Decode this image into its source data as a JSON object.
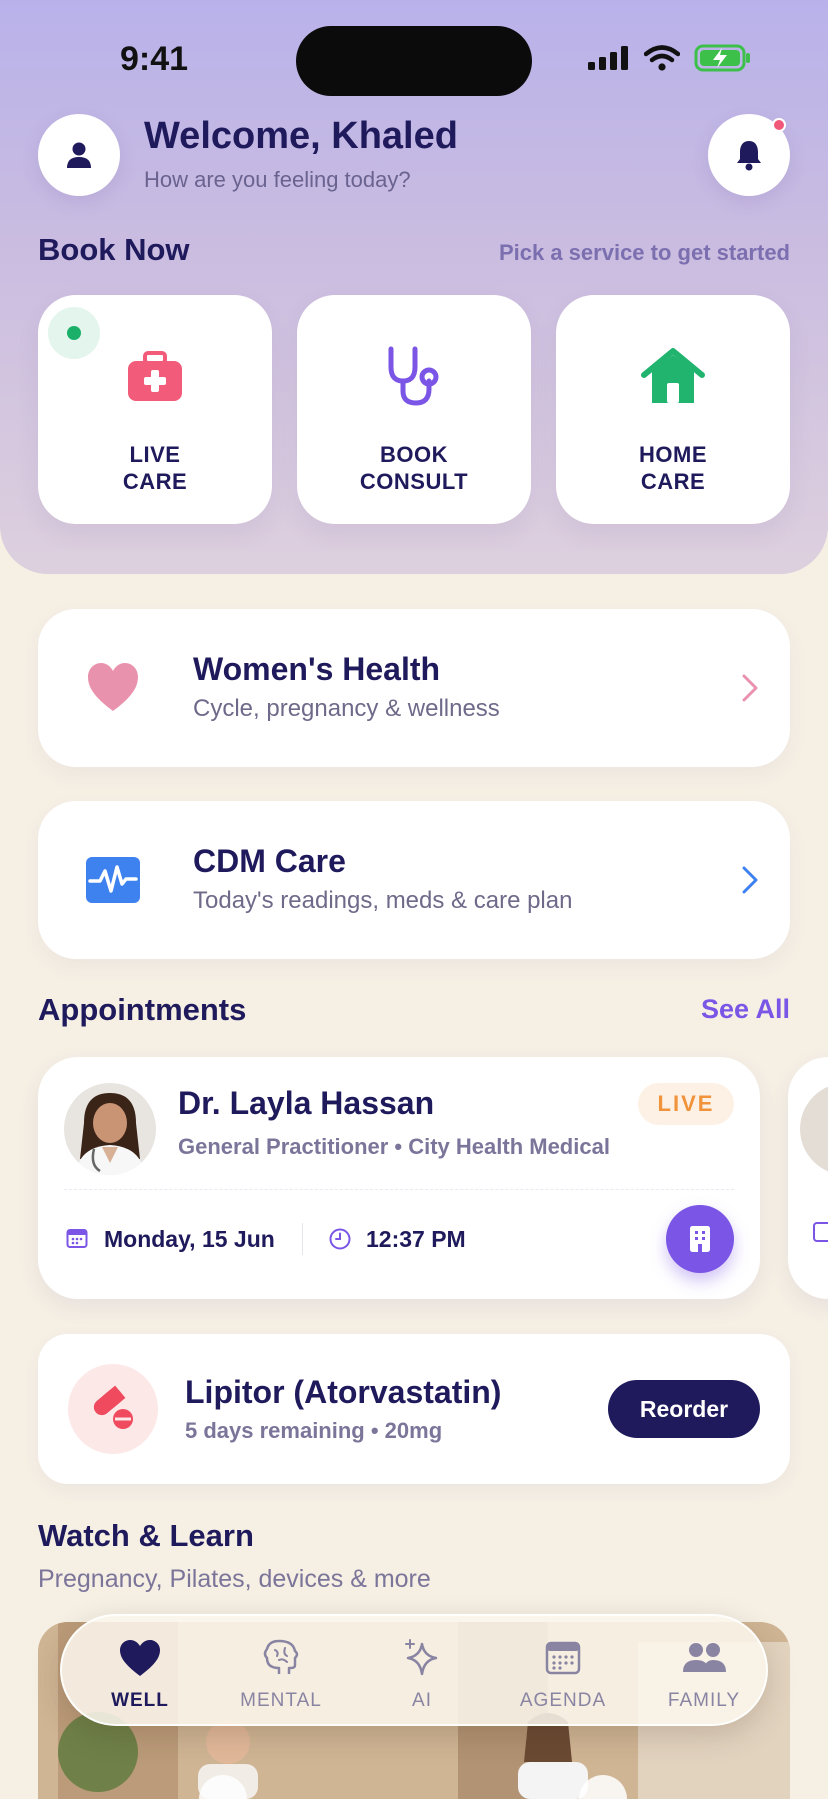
{
  "colors": {
    "primary": "#1f1a5c",
    "accent": "#7a55e6",
    "live": "#f0933a",
    "online": "#1bb06a",
    "heart": "#e992ae",
    "cdm": "#3e82f0"
  },
  "status_bar": {
    "time": "9:41"
  },
  "header": {
    "greeting": "Welcome, Khaled",
    "subtitle": "How are you feeling today?"
  },
  "book_now": {
    "title": "Book Now",
    "hint": "Pick a service to get started",
    "services": [
      {
        "label": "LIVE\nCARE",
        "icon": "first-aid-kit-icon"
      },
      {
        "label": "BOOK\nCONSULT",
        "icon": "stethoscope-icon"
      },
      {
        "label": "HOME\nCARE",
        "icon": "house-icon"
      }
    ]
  },
  "womens_health": {
    "title": "Women's Health",
    "subtitle": "Cycle, pregnancy & wellness",
    "icon": "heart-icon"
  },
  "cdm_care": {
    "title": "CDM Care",
    "subtitle": "Today's readings, meds & care plan",
    "icon": "heart-monitor-icon"
  },
  "appointments": {
    "title": "Appointments",
    "see_all": "See All",
    "items": [
      {
        "doctor": "Dr. Layla Hassan",
        "specialty": "General Practitioner • City Health Medical",
        "badge": "LIVE",
        "date": "Monday, 15 Jun",
        "time": "12:37 PM"
      }
    ]
  },
  "medication": {
    "name": "Lipitor (Atorvastatin)",
    "detail": "5 days remaining • 20mg",
    "action": "Reorder"
  },
  "watch_learn": {
    "title": "Watch & Learn",
    "subtitle": "Pregnancy, Pilates, devices & more"
  },
  "tabs": [
    {
      "label": "WELL",
      "icon": "heart-icon",
      "active": true
    },
    {
      "label": "MENTAL",
      "icon": "brain-icon",
      "active": false
    },
    {
      "label": "AI",
      "icon": "sparkle-icon",
      "active": false
    },
    {
      "label": "AGENDA",
      "icon": "calendar-icon",
      "active": false
    },
    {
      "label": "FAMILY",
      "icon": "family-icon",
      "active": false
    }
  ]
}
